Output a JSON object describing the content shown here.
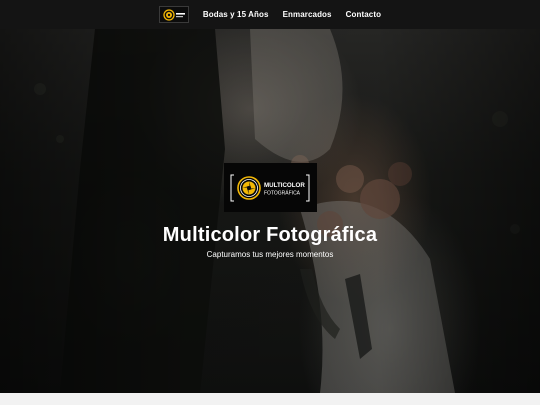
{
  "nav": {
    "logo_icon": "camera-aperture-logo",
    "links": [
      {
        "label": "Bodas y 15 Años"
      },
      {
        "label": "Enmarcados"
      },
      {
        "label": "Contacto"
      }
    ]
  },
  "hero": {
    "logo": {
      "icon": "camera-aperture-logo",
      "brand_line1": "MULTICOLOR",
      "brand_line2": "FOTOGRÁFICA"
    },
    "title": "Multicolor Fotográfica",
    "subtitle": "Capturamos tus mejores momentos"
  },
  "colors": {
    "accent": "#f2b705",
    "navbar": "#141414",
    "text": "#ffffff"
  }
}
